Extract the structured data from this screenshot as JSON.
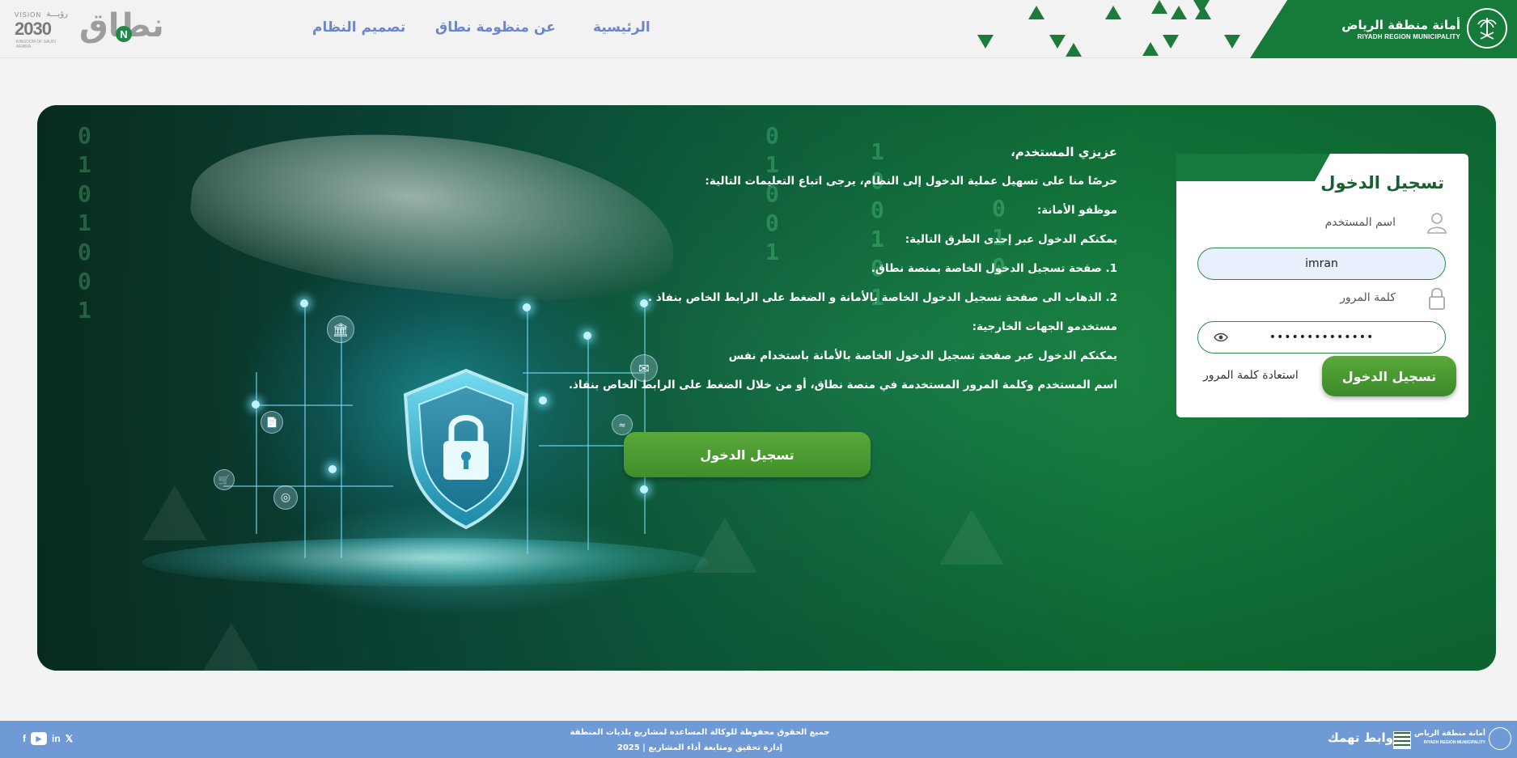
{
  "header": {
    "org_ar": "أمانة منطقة الرياض",
    "org_en": "RIYADH REGION MUNICIPALITY",
    "nav": [
      {
        "label": "الرئيسية"
      },
      {
        "label": "عن منظومة نطاق"
      },
      {
        "label": "تصميم النظام"
      }
    ],
    "vision_word": "VISION",
    "vision_ar": "رؤيـــة",
    "vision_year": "2030",
    "vision_sub": "KINGDOM OF SAUDI ARABIA",
    "nitaq_text": "نطاق",
    "nitaq_letter": "N"
  },
  "instructions": {
    "lines": [
      "عزيزي المستخدم،",
      "حرصًا منا على تسهيل عملية الدخول إلى النظام، يرجى اتباع التعليمات التالية:",
      "موظفو الأمانة:",
      "يمكنكم الدخول عبر إحدى الطرق التالية:",
      "1. صفحة تسجيل الدخول الخاصة بمنصة نطاق.",
      "2. الذهاب الى صفحة تسجيل الدخول الخاصة بالأمانة و الضغط على الرابط الخاص بنفاذ .",
      "مستخدمو الجهات الخارجية:",
      "يمكنكم الدخول عبر صفحة تسجيل الدخول الخاصة بالأمانة باستخدام نفس",
      "اسم المستخدم وكلمة المرور المستخدمة في منصة نطاق، أو من خلال الضغط على الرابط الخاص بنفاذ."
    ],
    "button_label": "تسجيل الدخول"
  },
  "login": {
    "title": "تسجيل الدخول",
    "username_label": "اسم المستخدم",
    "username_value": "imran",
    "password_label": "كلمة المرور",
    "password_value": "••••••••••••••",
    "submit_label": "تسجيل الدخول",
    "forgot_label": "استعادة كلمة المرور"
  },
  "footer": {
    "copyright_line1": "جميع الحقوق محفوظة للوكالة المساعدة لمشاريع بلديات المنطقة",
    "copyright_line2": "إدارة تحقيق ومتابعة أداء المشاريع | 2025",
    "links_title": "روابط تهمك",
    "org_ar": "أمانة منطقة الرياض",
    "org_en": "RIYADH REGION MUNICIPALITY",
    "social": [
      "f",
      "▶",
      "in",
      "𝕏"
    ]
  },
  "icons": {
    "user": "user-icon",
    "lock": "lock-icon",
    "eye": "eye-icon",
    "bank": "bank-icon",
    "mail": "mail-icon",
    "cart": "cart-icon",
    "fingerprint": "fingerprint-icon",
    "wifi": "wifi-icon",
    "document": "document-icon"
  },
  "colors": {
    "brand_green": "#157a3c",
    "button_green": "#4a9a32",
    "nav_blue": "#6b87c8",
    "footer_blue": "#6f9ad6"
  }
}
